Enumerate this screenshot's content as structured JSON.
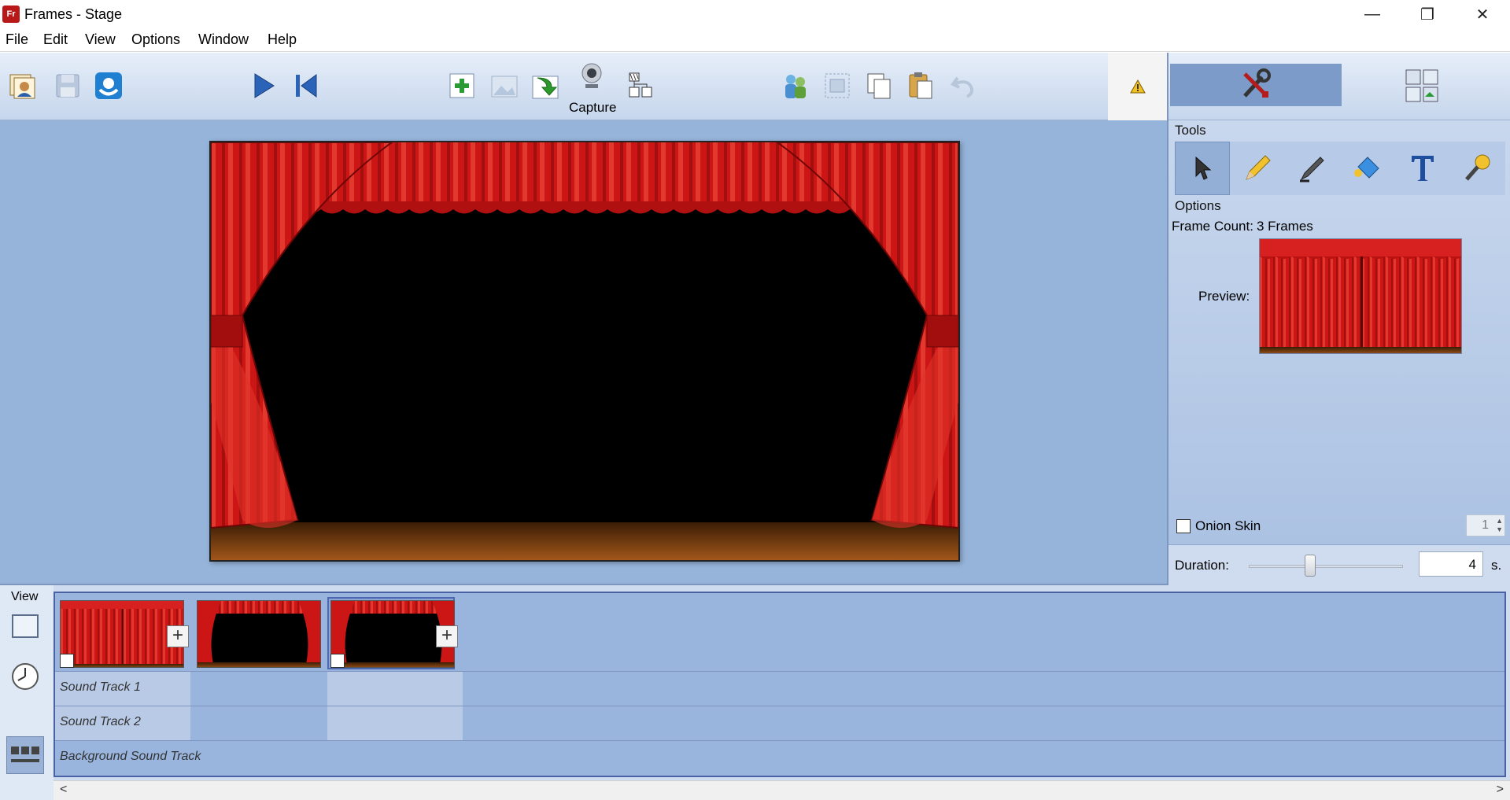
{
  "window": {
    "app_icon_text": "Fr",
    "title": "Frames - Stage",
    "minimize": "—",
    "restore": "❐",
    "close": "✕"
  },
  "menu": [
    "File",
    "Edit",
    "View",
    "Options",
    "Window",
    "Help"
  ],
  "toolbar": {
    "capture_label": "Capture",
    "icons": [
      "open-photos-icon",
      "save-icon",
      "share-icon",
      "play-icon",
      "rewind-icon",
      "add-frame-icon",
      "import-image-icon",
      "import-icon",
      "webcam-icon",
      "film-frames-icon",
      "users-icon",
      "select-frame-icon",
      "copy-icon",
      "paste-icon",
      "undo-icon",
      "warning-icon"
    ]
  },
  "right_panel": {
    "tools_title": "Tools",
    "options_title": "Options",
    "frame_count_label": "Frame Count:",
    "frame_count_value": "3 Frames",
    "preview_label": "Preview:",
    "onion_skin_label": "Onion Skin",
    "onion_skin_checked": false,
    "onion_skin_value": "1",
    "duration_label": "Duration:",
    "duration_value": "4",
    "duration_unit": "s.",
    "duration_slider_fraction": 0.4,
    "tools": [
      "select-arrow-icon",
      "pencil-icon",
      "pen-icon",
      "fill-bucket-icon",
      "text-tool-icon",
      "microphone-icon"
    ],
    "selected_tool": "select-arrow-icon"
  },
  "timeline": {
    "view_label": "View",
    "frames": [
      {
        "type": "closed-curtain",
        "selected": false
      },
      {
        "type": "open-curtain",
        "selected": false
      },
      {
        "type": "open-curtain",
        "selected": true
      }
    ],
    "tracks": [
      "Sound Track 1",
      "Sound Track 2",
      "Background Sound Track"
    ],
    "scroll_left": "<",
    "scroll_right": ">"
  },
  "colors": {
    "curtain_red": "#d21a1a",
    "stage_bg": "#96b4da",
    "panel_bg": "#cddbef",
    "selected_frame_border": "#4d68b0"
  }
}
